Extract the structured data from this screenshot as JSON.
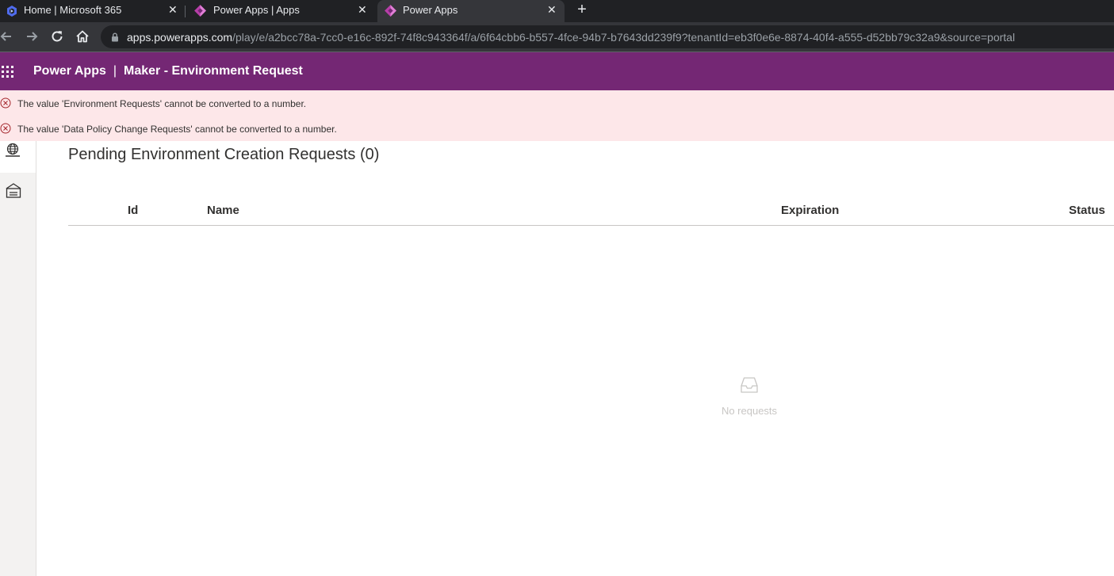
{
  "browser": {
    "tabs": [
      {
        "title": "Home | Microsoft 365",
        "icon": "microsoft365-icon",
        "active": false
      },
      {
        "title": "Power Apps | Apps",
        "icon": "powerapps-icon",
        "active": false
      },
      {
        "title": "Power Apps",
        "icon": "powerapps-icon",
        "active": true
      }
    ],
    "url_host": "apps.powerapps.com",
    "url_path": "/play/e/a2bcc78a-7cc0-e16c-892f-74f8c943364f/a/6f64cbb6-b557-4fce-94b7-b7643dd239f9?tenantId=eb3f0e6e-8874-40f4-a555-d52bb79c32a9&source=portal"
  },
  "header": {
    "product": "Power Apps",
    "separator": "|",
    "app_name": "Maker - Environment Request",
    "color": "#742774"
  },
  "errors": [
    "The value 'Environment Requests' cannot be converted to a number.",
    "The value 'Data Policy Change Requests' cannot be converted to a number."
  ],
  "sidebar": {
    "items": [
      {
        "icon": "globe-environment-icon",
        "selected": true
      },
      {
        "icon": "policy-shield-icon",
        "selected": false
      }
    ]
  },
  "main": {
    "title": "Pending Environment Creation Requests (0)",
    "columns": [
      "Id",
      "Name",
      "Expiration",
      "Status"
    ],
    "rows": [],
    "empty_text": "No requests"
  }
}
